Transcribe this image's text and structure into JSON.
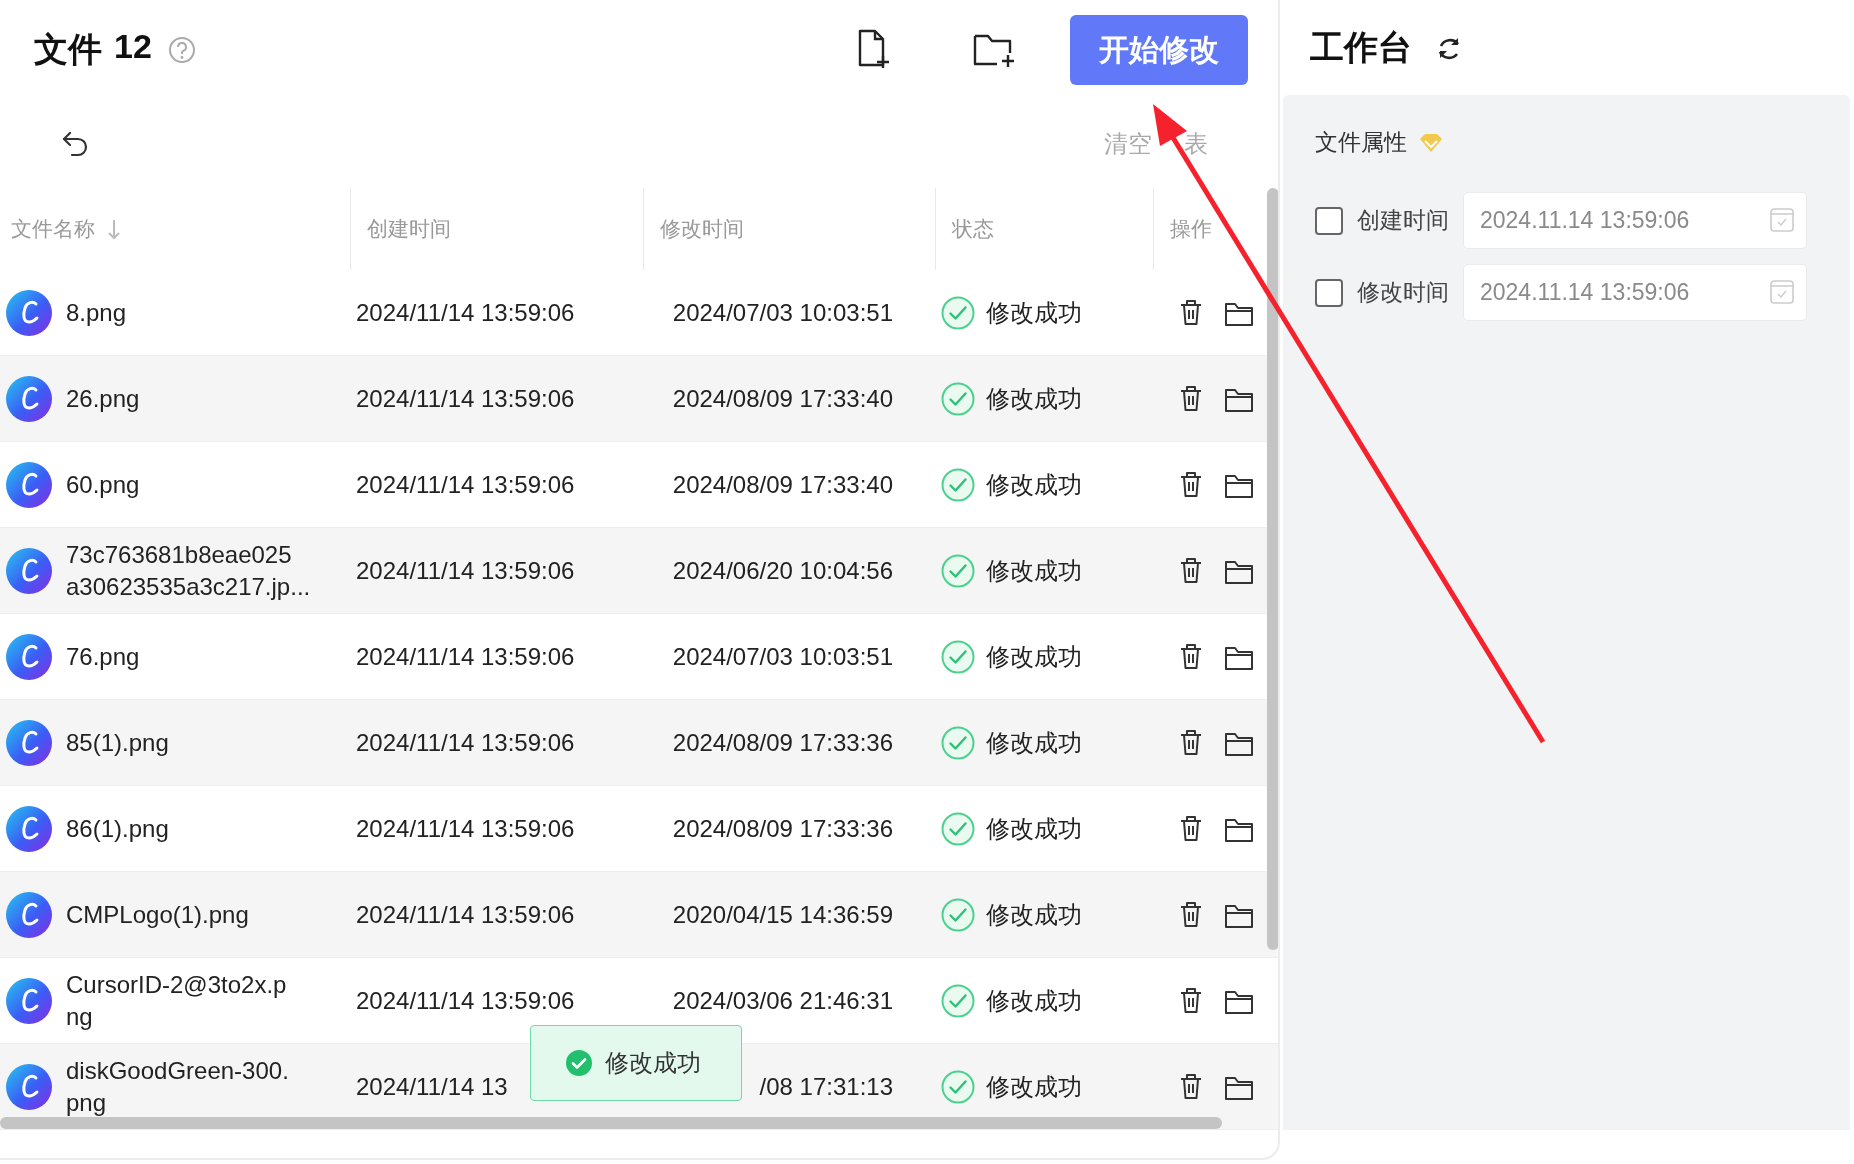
{
  "file_panel": {
    "title": "文件",
    "count": "12",
    "start_button": "开始修改",
    "clear_list": [
      "清空",
      "表"
    ],
    "table": {
      "columns": [
        {
          "label": "文件名称",
          "sorted": true
        },
        {
          "label": "创建时间",
          "sorted": false
        },
        {
          "label": "修改时间",
          "sorted": false
        },
        {
          "label": "状态",
          "sorted": false
        },
        {
          "label": "操作",
          "sorted": false
        }
      ],
      "rows": [
        {
          "name": "8.png",
          "created": "2024/11/14 13:59:06",
          "modified": "2024/07/03 10:03:51",
          "status": "修改成功"
        },
        {
          "name": "26.png",
          "created": "2024/11/14 13:59:06",
          "modified": "2024/08/09 17:33:40",
          "status": "修改成功"
        },
        {
          "name": "60.png",
          "created": "2024/11/14 13:59:06",
          "modified": "2024/08/09 17:33:40",
          "status": "修改成功"
        },
        {
          "name": "73c763681b8eae025\na30623535a3c217.jp...",
          "created": "2024/11/14 13:59:06",
          "modified": "2024/06/20 10:04:56",
          "status": "修改成功"
        },
        {
          "name": "76.png",
          "created": "2024/11/14 13:59:06",
          "modified": "2024/07/03 10:03:51",
          "status": "修改成功"
        },
        {
          "name": "85(1).png",
          "created": "2024/11/14 13:59:06",
          "modified": "2024/08/09 17:33:36",
          "status": "修改成功"
        },
        {
          "name": "86(1).png",
          "created": "2024/11/14 13:59:06",
          "modified": "2024/08/09 17:33:36",
          "status": "修改成功"
        },
        {
          "name": "CMPLogo(1).png",
          "created": "2024/11/14 13:59:06",
          "modified": "2020/04/15 14:36:59",
          "status": "修改成功"
        },
        {
          "name": "CursorID-2@3to2x.p\nng",
          "created": "2024/11/14 13:59:06",
          "modified": "2024/03/06 21:46:31",
          "status": "修改成功"
        },
        {
          "name": "diskGoodGreen-300.\npng",
          "created": "2024/11/14 13",
          "modified": "/08 17:31:13",
          "status": "修改成功"
        }
      ]
    },
    "toast": {
      "text": "修改成功"
    }
  },
  "workbench": {
    "title": "工作台",
    "section": "文件属性",
    "fields": [
      {
        "label": "创建时间",
        "checked": false,
        "value": "2024.11.14 13:59:06"
      },
      {
        "label": "修改时间",
        "checked": false,
        "value": "2024.11.14 13:59:06"
      }
    ]
  }
}
